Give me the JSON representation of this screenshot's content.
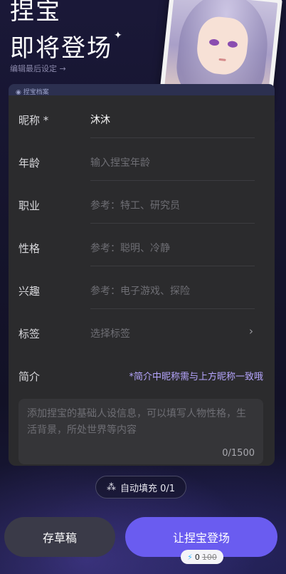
{
  "header": {
    "title_line1": "捏宝",
    "title_line2": "即将登场",
    "sparkle": "✦",
    "subtitle": "编辑最后设定 →"
  },
  "tab": {
    "label": "捏宝档案"
  },
  "form": {
    "rows": [
      {
        "label": "昵称 *",
        "value": "沐沐",
        "placeholder": ""
      },
      {
        "label": "年龄",
        "value": "",
        "placeholder": "输入捏宝年龄"
      },
      {
        "label": "职业",
        "value": "",
        "placeholder": "参考：特工、研究员"
      },
      {
        "label": "性格",
        "value": "",
        "placeholder": "参考：聪明、冷静"
      },
      {
        "label": "兴趣",
        "value": "",
        "placeholder": "参考：电子游戏、探险"
      },
      {
        "label": "标签",
        "value": "",
        "placeholder": "选择标签",
        "chevron": "›"
      }
    ],
    "intro": {
      "label": "简介",
      "hint": "*简介中昵称需与上方昵称一致哦",
      "placeholder": "添加捏宝的基础人设信息，可以填写人物性格，生活背景，所处世界等内容",
      "counter": "0/1500"
    }
  },
  "actions": {
    "autofill_label": "自动填充 0/1",
    "draft_label": "存草稿",
    "launch_label": "让捏宝登场",
    "cost_now": "0",
    "cost_old": "100"
  },
  "colors": {
    "accent": "#6a5cf0",
    "hint": "#b6a6ff",
    "panel": "#2b2b2d"
  }
}
